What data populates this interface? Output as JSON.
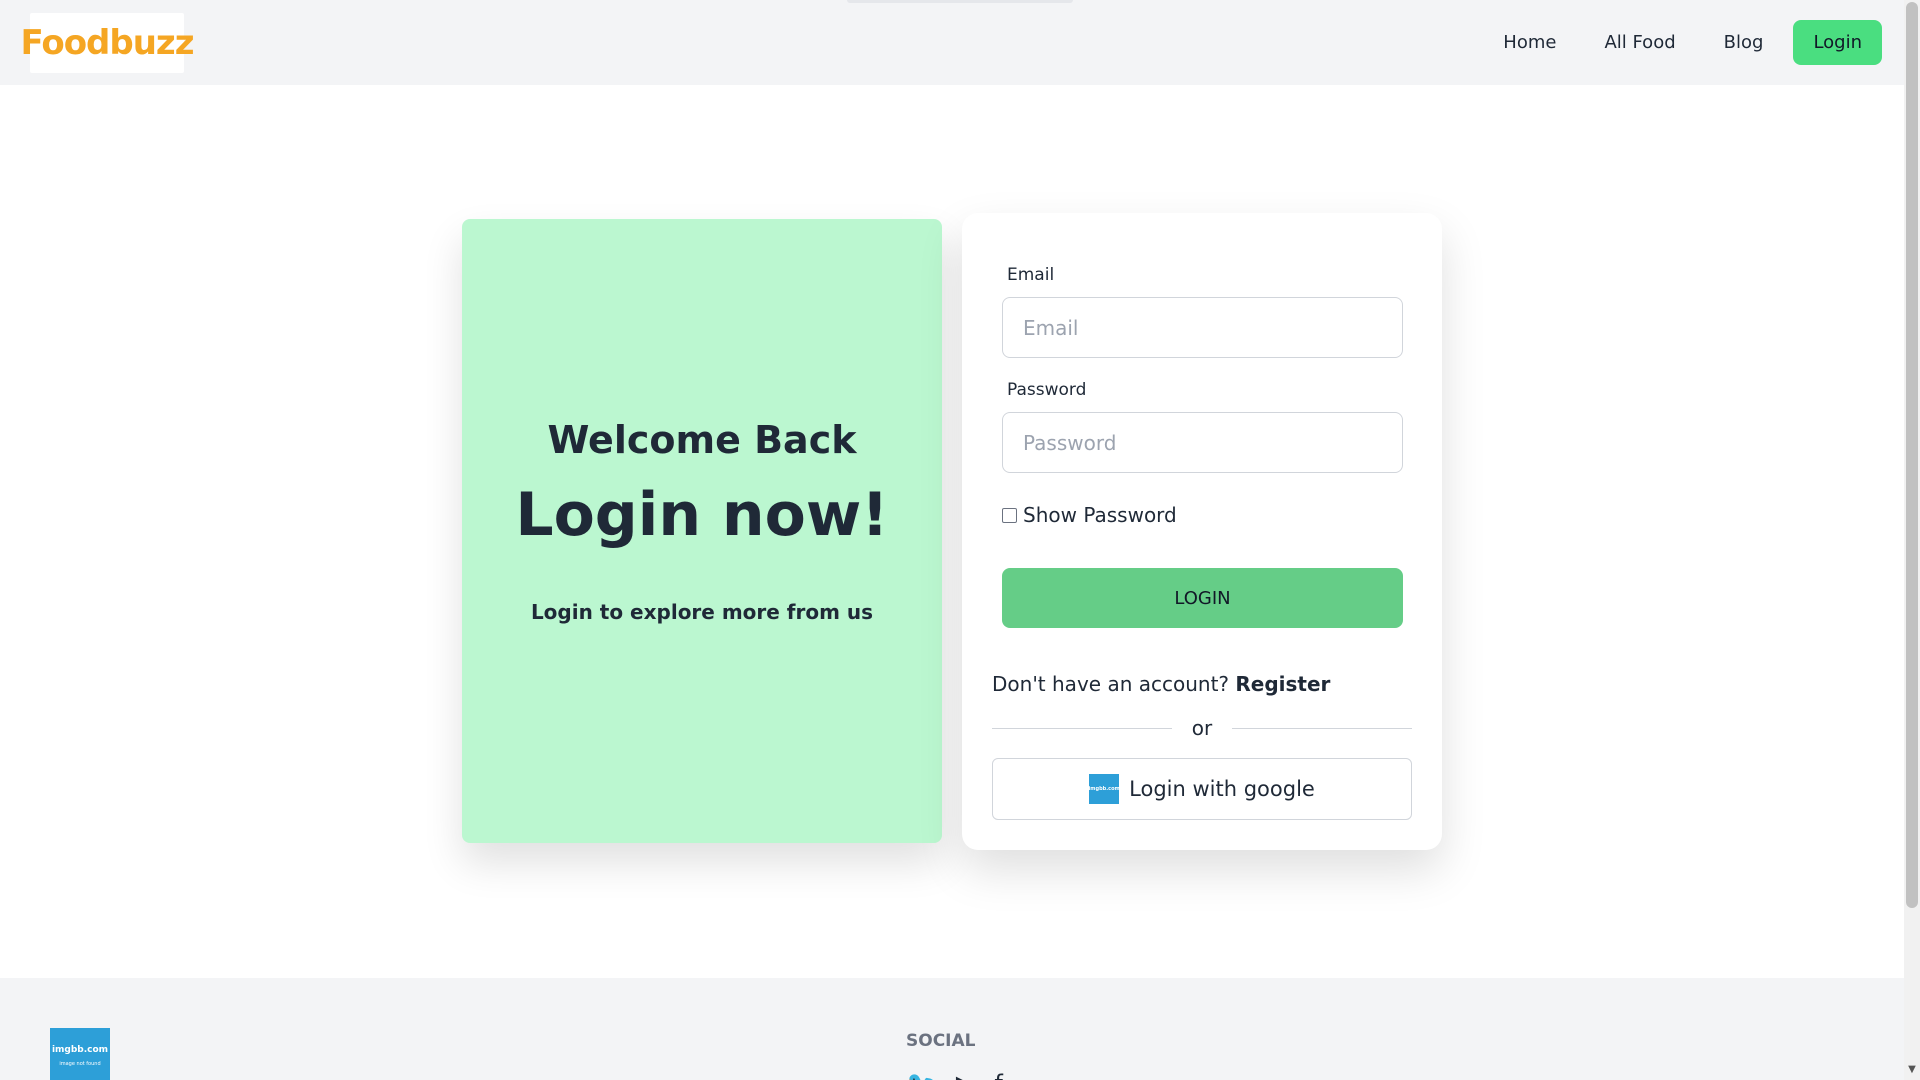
{
  "header": {
    "logo_text": "Foodbuzz",
    "nav": {
      "home": "Home",
      "all_food": "All Food",
      "blog": "Blog",
      "login": "Login"
    }
  },
  "welcome": {
    "title": "Welcome Back",
    "heading": "Login now!",
    "subtitle": "Login to explore more from us"
  },
  "login_form": {
    "email_label": "Email",
    "email_placeholder": "Email",
    "email_value": "",
    "password_label": "Password",
    "password_placeholder": "Password",
    "password_value": "",
    "show_password_label": "Show Password",
    "submit_label": "LOGIN",
    "register_prompt": "Don't have an account?",
    "register_link": "Register",
    "or_text": "or",
    "google_label": "Login with google",
    "google_icon_text": "imgbb.com"
  },
  "footer": {
    "logo_text": "imgbb.com",
    "logo_subtext": "image not found",
    "social_title": "SOCIAL",
    "social_icons": [
      "twitter-icon",
      "youtube-icon",
      "facebook-icon"
    ]
  },
  "colors": {
    "header_bg": "#f3f4f6",
    "nav_login_bg": "#4ade80",
    "welcome_bg": "#bbf7d0",
    "login_button_bg": "#65cd87",
    "text": "#1f2937"
  }
}
